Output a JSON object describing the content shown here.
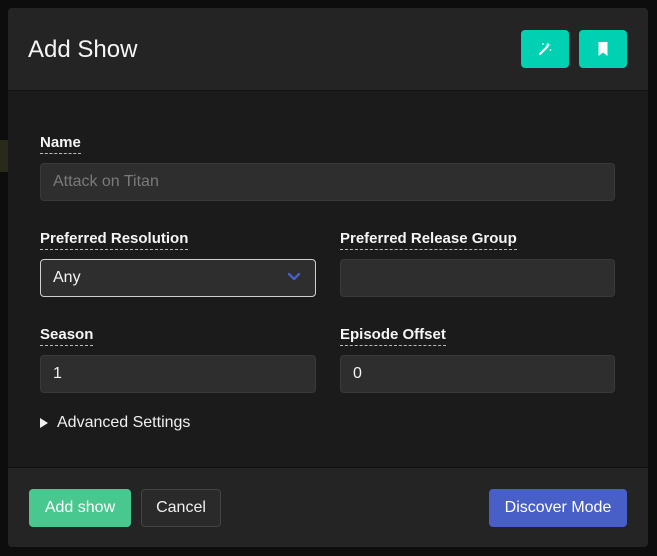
{
  "modal": {
    "title": "Add Show",
    "header_buttons": [
      {
        "icon": "magic-wand-icon"
      },
      {
        "icon": "bookmark-icon"
      }
    ]
  },
  "form": {
    "name": {
      "label": "Name",
      "value": "",
      "placeholder": "Attack on Titan"
    },
    "resolution": {
      "label": "Preferred Resolution",
      "selected": "Any"
    },
    "release_group": {
      "label": "Preferred Release Group",
      "value": ""
    },
    "season": {
      "label": "Season",
      "value": "1"
    },
    "episode_offset": {
      "label": "Episode Offset",
      "value": "0"
    },
    "advanced_label": "Advanced Settings"
  },
  "footer": {
    "add_label": "Add show",
    "cancel_label": "Cancel",
    "discover_label": "Discover Mode"
  },
  "colors": {
    "primary": "#00d1b2",
    "success": "#48c78e",
    "link": "#485fc7",
    "chevron": "#485fc7"
  }
}
